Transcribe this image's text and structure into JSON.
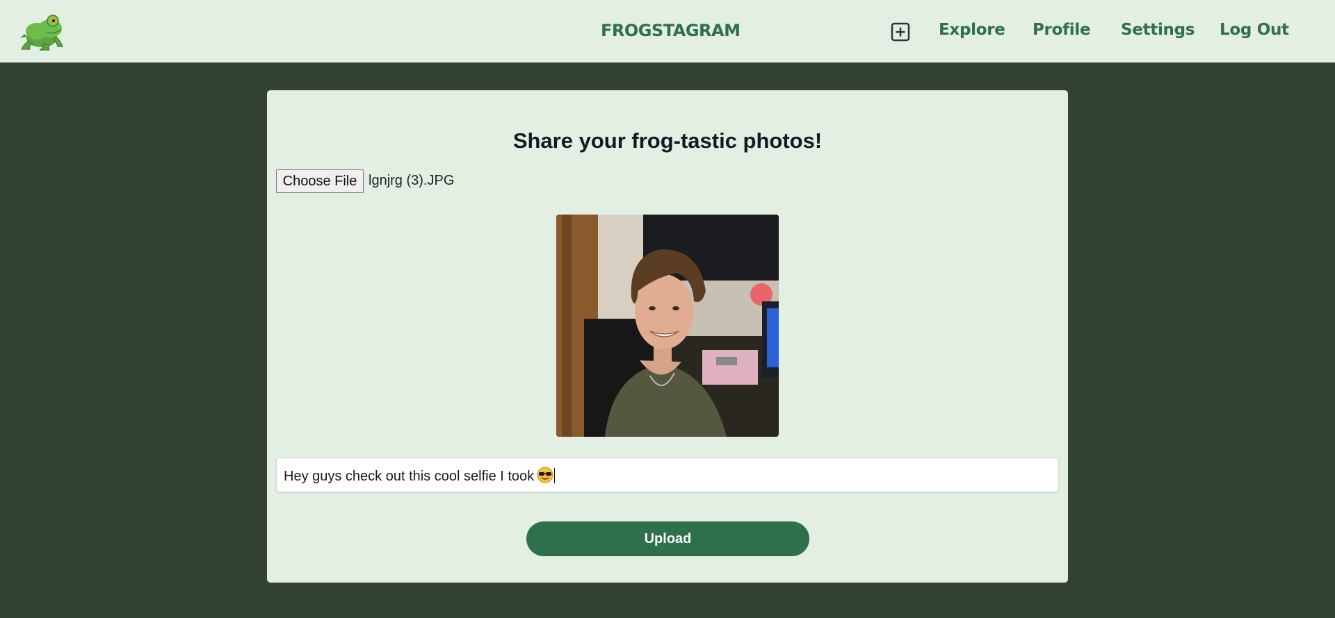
{
  "header": {
    "brand": "FROGSTAGRAM",
    "nav": {
      "explore": "Explore",
      "profile": "Profile",
      "settings": "Settings",
      "logout": "Log Out"
    }
  },
  "upload_form": {
    "heading": "Share your frog-tastic photos!",
    "choose_file_label": "Choose File",
    "selected_file": "lgnjrg (3).JPG",
    "caption_value": "Hey guys check out this cool selfie I took",
    "caption_emoji": "smiling-face-with-sunglasses",
    "upload_label": "Upload"
  },
  "icons": {
    "logo": "frog-icon",
    "add_post": "plus-square-icon"
  },
  "colors": {
    "background": "#334331",
    "surface": "#e4efe3",
    "accent": "#2d7049"
  }
}
